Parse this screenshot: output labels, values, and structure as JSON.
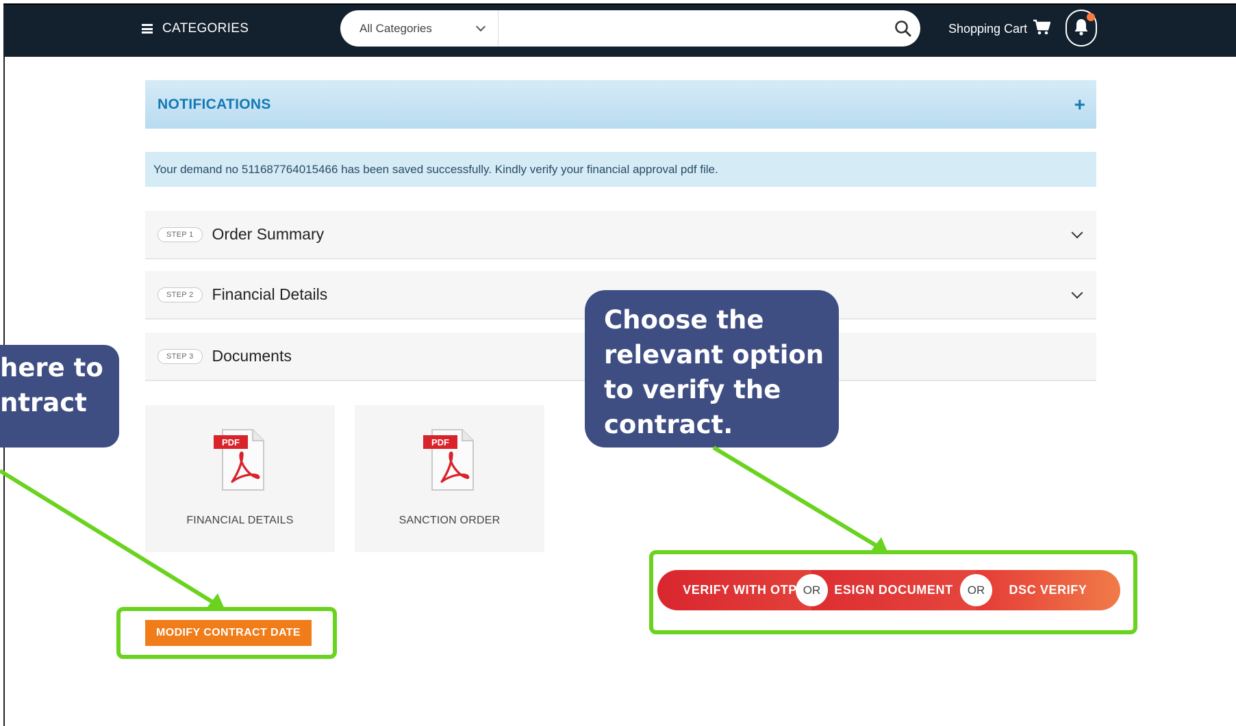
{
  "header": {
    "categories_label": "CATEGORIES",
    "category_select_value": "All Categories",
    "search_placeholder": "",
    "cart_label": "Shopping Cart"
  },
  "notifications": {
    "title": "NOTIFICATIONS",
    "expand_symbol": "+"
  },
  "alert_message": "Your demand no 511687764015466 has been saved successfully. Kindly verify your financial approval pdf file.",
  "steps": [
    {
      "badge": "STEP 1",
      "title": "Order Summary"
    },
    {
      "badge": "STEP 2",
      "title": "Financial Details"
    },
    {
      "badge": "STEP 3",
      "title": "Documents"
    }
  ],
  "documents": [
    {
      "label": "FINANCIAL DETAILS",
      "icon_tag": "PDF"
    },
    {
      "label": "SANCTION ORDER",
      "icon_tag": "PDF"
    }
  ],
  "actions": {
    "modify_contract_date": "MODIFY CONTRACT DATE",
    "verify_with_otp": "VERIFY WITH OTP",
    "esign_document": "ESIGN DOCUMENT",
    "dsc_verify": "DSC VERIFY",
    "or_separator": "OR"
  },
  "callouts": {
    "right": [
      "Choose the",
      "relevant option",
      "to verify the",
      "contract."
    ],
    "left": [
      "here to",
      "ntract"
    ]
  },
  "colors": {
    "topbar": "#13212e",
    "notification_title": "#1479b5",
    "highlight_green": "#6ad31f",
    "callout_bg": "#3e4e82",
    "modify_button": "#f07c1a",
    "verify_red": "#d9262f"
  }
}
